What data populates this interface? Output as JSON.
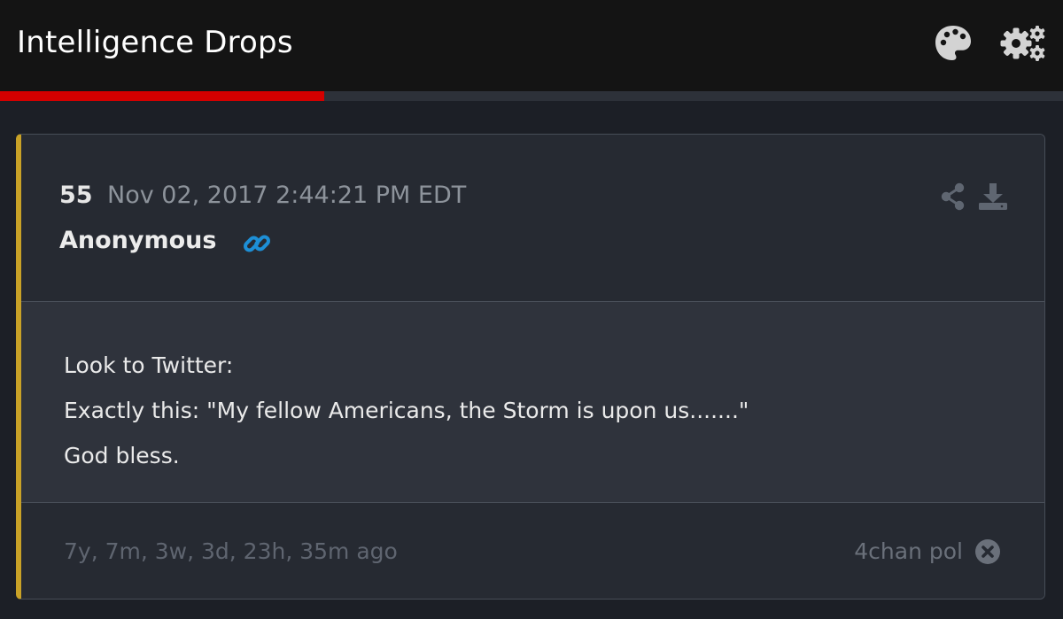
{
  "app": {
    "title": "Intelligence Drops",
    "icons": [
      "palette-icon",
      "settings-icon"
    ],
    "progress": 0.305,
    "colors": {
      "progress": "#d40000",
      "card_accent": "#c9a227",
      "link": "#1d8fd6"
    }
  },
  "post": {
    "number": "55",
    "date": "Nov 02, 2017 2:44:21 PM EDT",
    "author": "Anonymous",
    "icons": [
      "link-icon",
      "share-icon",
      "download-icon"
    ],
    "lines": [
      "Look to Twitter:",
      "Exactly this: \"My fellow Americans, the Storm is upon us.......\"",
      "God bless."
    ],
    "time_ago": "7y, 7m, 3w, 3d, 23h, 35m ago",
    "source": "4chan pol",
    "footer_icon": "close-icon"
  }
}
